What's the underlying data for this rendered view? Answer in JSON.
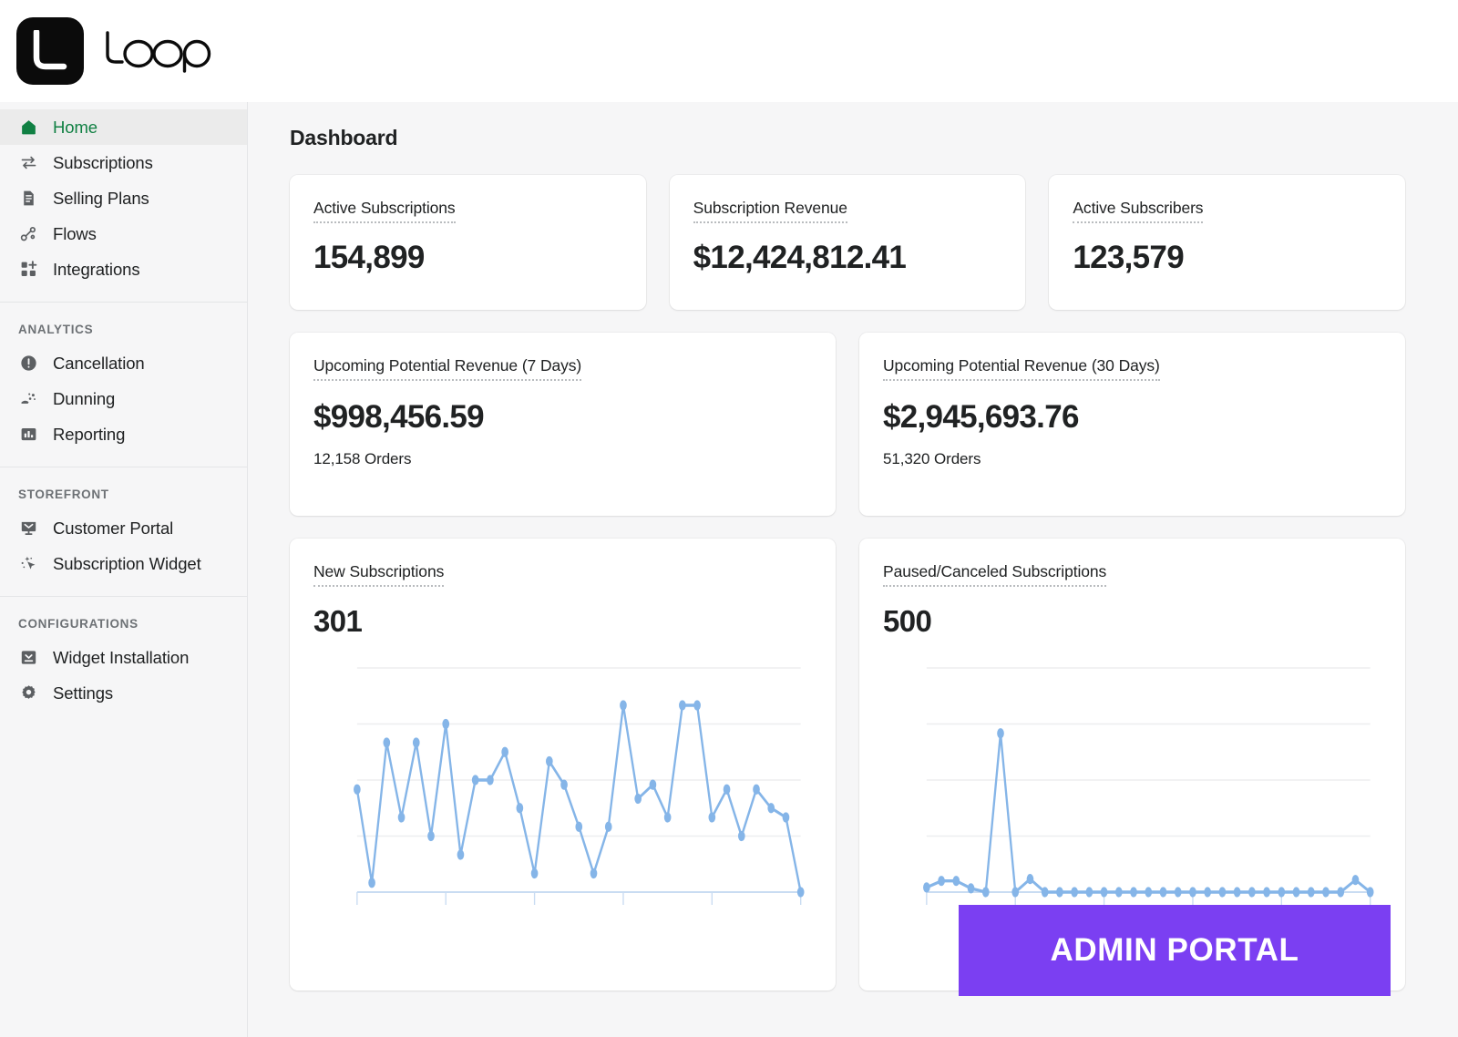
{
  "brand": {
    "name": "Loop",
    "logo_letter": "L",
    "wordmark": "loop"
  },
  "page": {
    "title": "Dashboard"
  },
  "sidebar": {
    "groups": [
      {
        "title": null,
        "items": [
          {
            "label": "Home",
            "icon": "home-icon",
            "active": true
          },
          {
            "label": "Subscriptions",
            "icon": "transfer-icon",
            "active": false
          },
          {
            "label": "Selling Plans",
            "icon": "document-icon",
            "active": false
          },
          {
            "label": "Flows",
            "icon": "flow-nodes-icon",
            "active": false
          },
          {
            "label": "Integrations",
            "icon": "grid-plus-icon",
            "active": false
          }
        ]
      },
      {
        "title": "ANALYTICS",
        "items": [
          {
            "label": "Cancellation",
            "icon": "alert-circle-icon",
            "active": false
          },
          {
            "label": "Dunning",
            "icon": "dunning-hand-icon",
            "active": false
          },
          {
            "label": "Reporting",
            "icon": "bar-chart-icon",
            "active": false
          }
        ]
      },
      {
        "title": "STOREFRONT",
        "items": [
          {
            "label": "Customer Portal",
            "icon": "monitor-icon",
            "active": false
          },
          {
            "label": "Subscription Widget",
            "icon": "cursor-sparkle-icon",
            "active": false
          }
        ]
      },
      {
        "title": "CONFIGURATIONS",
        "items": [
          {
            "label": "Widget Installation",
            "icon": "inbox-download-icon",
            "active": false
          },
          {
            "label": "Settings",
            "icon": "gear-icon",
            "active": false
          }
        ]
      }
    ]
  },
  "kpis": [
    {
      "label": "Active Subscriptions",
      "value": "154,899"
    },
    {
      "label": "Subscription Revenue",
      "value": "$12,424,812.41"
    },
    {
      "label": "Active Subscribers",
      "value": "123,579"
    }
  ],
  "revenue_cards": [
    {
      "label": "Upcoming Potential Revenue (7 Days)",
      "value": "$998,456.59",
      "sub": "12,158 Orders"
    },
    {
      "label": "Upcoming Potential Revenue (30 Days)",
      "value": "$2,945,693.76",
      "sub": "51,320 Orders"
    }
  ],
  "chart_cards": [
    {
      "label": "New Subscriptions",
      "value": "301"
    },
    {
      "label": "Paused/Canceled Subscriptions",
      "value": "500"
    }
  ],
  "overlay": {
    "label": "ADMIN PORTAL",
    "color": "#7B3FF2"
  },
  "colors": {
    "accent_green": "#108043",
    "chart_line": "#85B5E8",
    "chart_grid": "#EDEEEF",
    "text_primary": "#202223",
    "text_muted": "#6D7175",
    "bg_page": "#F6F6F7",
    "card_bg": "#FFFFFF",
    "overlay_purple": "#7B3FF2"
  },
  "chart_data": [
    {
      "type": "line",
      "title": "New Subscriptions",
      "total": 301,
      "xlabel": "",
      "ylabel": "",
      "ylim": [
        0,
        24
      ],
      "grid": true,
      "legend": null,
      "x": [
        1,
        2,
        3,
        4,
        5,
        6,
        7,
        8,
        9,
        10,
        11,
        12,
        13,
        14,
        15,
        16,
        17,
        18,
        19,
        20,
        21,
        22,
        23,
        24,
        25,
        26,
        27,
        28,
        29,
        30,
        31
      ],
      "values": [
        11,
        1,
        16,
        8,
        16,
        6,
        18,
        4,
        12,
        12,
        15,
        9,
        2,
        14,
        11.5,
        7,
        2,
        7,
        20,
        10,
        11.5,
        8,
        20,
        20,
        8,
        11,
        6,
        11,
        9,
        8,
        0
      ]
    },
    {
      "type": "line",
      "title": "Paused/Canceled Subscriptions",
      "total": 500,
      "xlabel": "",
      "ylabel": "",
      "ylim": [
        0,
        24
      ],
      "grid": true,
      "legend": null,
      "x": [
        1,
        2,
        3,
        4,
        5,
        6,
        7,
        8,
        9,
        10,
        11,
        12,
        13,
        14,
        15,
        16,
        17,
        18,
        19,
        20,
        21,
        22,
        23,
        24,
        25,
        26,
        27,
        28,
        29,
        30,
        31
      ],
      "values": [
        0.5,
        1.2,
        1.2,
        0.4,
        0,
        17,
        0,
        1.4,
        0,
        0,
        0,
        0,
        0,
        0,
        0,
        0,
        0,
        0,
        0,
        0,
        0,
        0,
        0,
        0,
        0,
        0,
        0,
        0,
        0,
        1.3,
        0
      ]
    }
  ]
}
